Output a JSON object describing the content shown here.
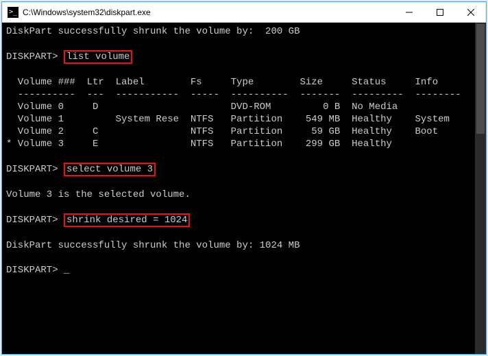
{
  "window": {
    "title": "C:\\Windows\\system32\\diskpart.exe"
  },
  "lines": {
    "shrunk1": "DiskPart successfully shrunk the volume by:  200 GB",
    "prompt": "DISKPART>",
    "cmd_list": "list volume",
    "header": "  Volume ###  Ltr  Label        Fs     Type        Size     Status     Info",
    "divider": "  ----------  ---  -----------  -----  ----------  -------  ---------  --------",
    "v0": "  Volume 0     D                       DVD-ROM         0 B  No Media",
    "v1": "  Volume 1         System Rese  NTFS   Partition    549 MB  Healthy    System",
    "v2": "  Volume 2     C                NTFS   Partition     59 GB  Healthy    Boot",
    "v3": "* Volume 3     E                NTFS   Partition    299 GB  Healthy",
    "cmd_select": "select volume 3",
    "selected": "Volume 3 is the selected volume.",
    "cmd_shrink": "shrink desired = 1024",
    "shrunk2": "DiskPart successfully shrunk the volume by: 1024 MB",
    "cursor": "_"
  }
}
